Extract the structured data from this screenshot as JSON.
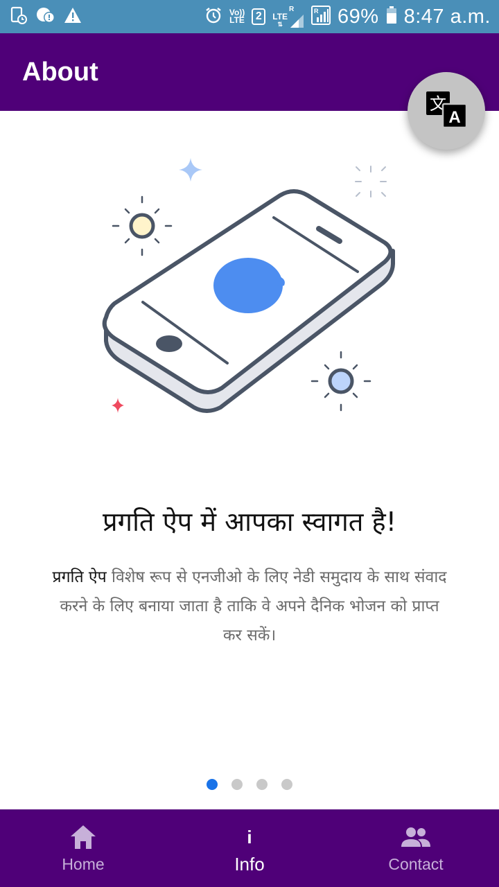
{
  "status_bar": {
    "volte_top": "Vo))",
    "volte_bottom": "LTE",
    "sim_slot": "2",
    "network_type": "LTE",
    "roaming": "R",
    "battery_percent": "69%",
    "time": "8:47 a.m."
  },
  "app_bar": {
    "title": "About"
  },
  "fab": {
    "icon": "translate-icon",
    "glyph_hindi": "文",
    "glyph_latin": "A"
  },
  "illustration": {
    "icon": "phone-chat-illustration"
  },
  "content": {
    "headline": "प्रगति ऐप में आपका स्वागत है!",
    "description_highlight": "प्रगति ऐप",
    "description_rest": " विशेष रूप से एनजीओ के लिए नेडी समुदाय के साथ संवाद करने के लिए बनाया जाता है ताकि वे अपने दैनिक भोजन को प्राप्त कर सकें।"
  },
  "pagination": {
    "total": 4,
    "active_index": 0
  },
  "bottom_nav": {
    "items": [
      {
        "label": "Home",
        "icon": "home-icon"
      },
      {
        "label": "Info",
        "icon": "info-icon"
      },
      {
        "label": "Contact",
        "icon": "contacts-icon"
      }
    ],
    "active": "Info"
  },
  "colors": {
    "status_bar": "#4a8fb8",
    "primary": "#4f0078",
    "fab": "#c4c4c4",
    "accent": "#1a73e8",
    "bubble": "#4d8df0",
    "inactive_nav": "#c7b0d9"
  }
}
